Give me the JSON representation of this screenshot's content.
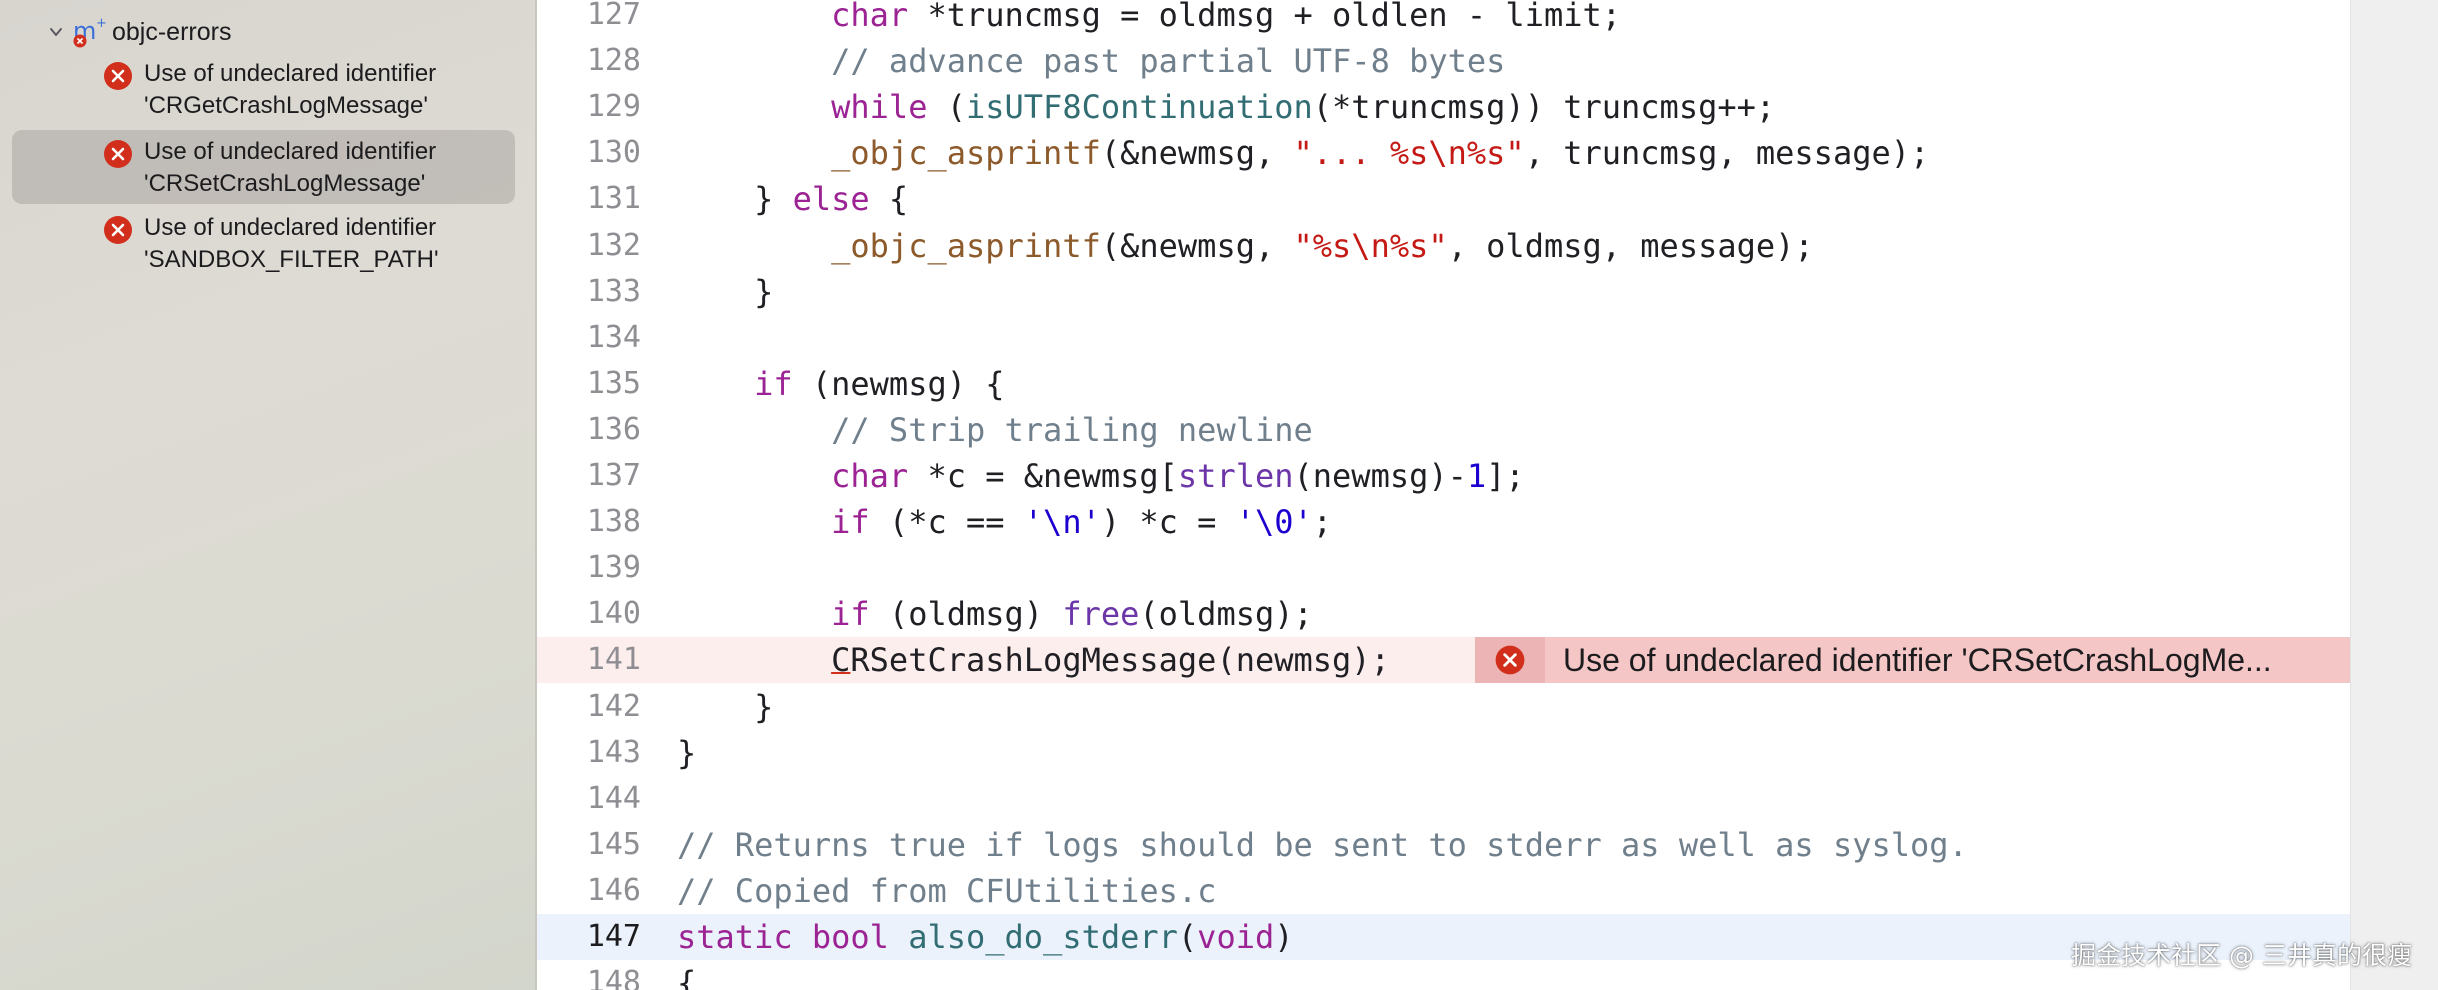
{
  "sidebar": {
    "root": {
      "label": "objc-errors",
      "icon": "module-error-icon"
    },
    "issues": [
      {
        "line1": "Use of undeclared identifier",
        "line2": "'CRGetCrashLogMessage'",
        "selected": false
      },
      {
        "line1": "Use of undeclared identifier",
        "line2": "'CRSetCrashLogMessage'",
        "selected": true
      },
      {
        "line1": "Use of undeclared identifier",
        "line2": "'SANDBOX_FILTER_PATH'",
        "selected": false
      }
    ]
  },
  "editor": {
    "lines": [
      {
        "n": "127",
        "tokens": [
          [
            "",
            "        "
          ],
          [
            "kw",
            "char"
          ],
          [
            "",
            " *truncmsg = oldmsg + oldlen - limit;"
          ]
        ]
      },
      {
        "n": "128",
        "tokens": [
          [
            "",
            "        "
          ],
          [
            "cm",
            "// advance past partial UTF-8 bytes"
          ]
        ]
      },
      {
        "n": "129",
        "tokens": [
          [
            "",
            "        "
          ],
          [
            "kw",
            "while"
          ],
          [
            "",
            " ("
          ],
          [
            "fn2",
            "isUTF8Continuation"
          ],
          [
            "",
            "(*truncmsg)) truncmsg++;"
          ]
        ]
      },
      {
        "n": "130",
        "tokens": [
          [
            "",
            "        "
          ],
          [
            "fn3",
            "_objc_asprintf"
          ],
          [
            "",
            "(&newmsg, "
          ],
          [
            "str",
            "\"... %s\\n%s\""
          ],
          [
            "",
            ", truncmsg, message);"
          ]
        ]
      },
      {
        "n": "131",
        "tokens": [
          [
            "",
            "    } "
          ],
          [
            "kw",
            "else"
          ],
          [
            "",
            " {"
          ]
        ]
      },
      {
        "n": "132",
        "tokens": [
          [
            "",
            "        "
          ],
          [
            "fn3",
            "_objc_asprintf"
          ],
          [
            "",
            "(&newmsg, "
          ],
          [
            "str",
            "\"%s\\n%s\""
          ],
          [
            "",
            ", oldmsg, message);"
          ]
        ]
      },
      {
        "n": "133",
        "tokens": [
          [
            "",
            "    }"
          ]
        ]
      },
      {
        "n": "134",
        "tokens": []
      },
      {
        "n": "135",
        "tokens": [
          [
            "",
            "    "
          ],
          [
            "kw",
            "if"
          ],
          [
            "",
            " (newmsg) {"
          ]
        ]
      },
      {
        "n": "136",
        "tokens": [
          [
            "",
            "        "
          ],
          [
            "cm",
            "// Strip trailing newline"
          ]
        ]
      },
      {
        "n": "137",
        "tokens": [
          [
            "",
            "        "
          ],
          [
            "kw",
            "char"
          ],
          [
            "",
            " *c = &newmsg["
          ],
          [
            "fn",
            "strlen"
          ],
          [
            "",
            "(newmsg)-"
          ],
          [
            "num",
            "1"
          ],
          [
            "",
            "];"
          ]
        ]
      },
      {
        "n": "138",
        "tokens": [
          [
            "",
            "        "
          ],
          [
            "kw",
            "if"
          ],
          [
            "",
            " (*c == "
          ],
          [
            "num",
            "'\\n'"
          ],
          [
            "",
            ") *c = "
          ],
          [
            "num",
            "'\\0'"
          ],
          [
            "",
            ";"
          ]
        ]
      },
      {
        "n": "139",
        "tokens": []
      },
      {
        "n": "140",
        "tokens": [
          [
            "",
            "        "
          ],
          [
            "kw",
            "if"
          ],
          [
            "",
            " (oldmsg) "
          ],
          [
            "fn",
            "free"
          ],
          [
            "",
            "(oldmsg);"
          ]
        ]
      },
      {
        "n": "141",
        "tokens": [
          [
            "",
            "        "
          ],
          [
            "err",
            "C"
          ],
          [
            "",
            "RSetCrashLogMessage(newmsg);"
          ]
        ],
        "error": true
      },
      {
        "n": "142",
        "tokens": [
          [
            "",
            "    }"
          ]
        ]
      },
      {
        "n": "143",
        "tokens": [
          [
            "",
            "}"
          ]
        ]
      },
      {
        "n": "144",
        "tokens": []
      },
      {
        "n": "145",
        "tokens": [
          [
            "cm",
            "// Returns true if logs should be sent to stderr as well as syslog."
          ]
        ]
      },
      {
        "n": "146",
        "tokens": [
          [
            "cm",
            "// Copied from CFUtilities.c"
          ]
        ]
      },
      {
        "n": "147",
        "tokens": [
          [
            "kw",
            "static"
          ],
          [
            "",
            " "
          ],
          [
            "kw",
            "bool"
          ],
          [
            "",
            " "
          ],
          [
            "fn2",
            "also_do_stderr"
          ],
          [
            "",
            "("
          ],
          [
            "kw",
            "void"
          ],
          [
            "",
            ")"
          ]
        ],
        "current": true
      },
      {
        "n": "148",
        "tokens": [
          [
            "",
            "{"
          ]
        ]
      }
    ],
    "error_banner": {
      "message": "Use of undeclared identifier 'CRSetCrashLogMe...",
      "icon": "error-circle-icon"
    }
  },
  "watermark": "掘金技术社区 @ 三井真的很瘦",
  "colors": {
    "error_red": "#d12f1b",
    "keyword": "#9b2393",
    "comment": "#707f8c",
    "string": "#c41a16",
    "number": "#1c00cf",
    "error_line_bg": "#fdeeee",
    "error_banner_bg": "#f4c6c6",
    "current_line_bg": "#ebf2fb"
  }
}
